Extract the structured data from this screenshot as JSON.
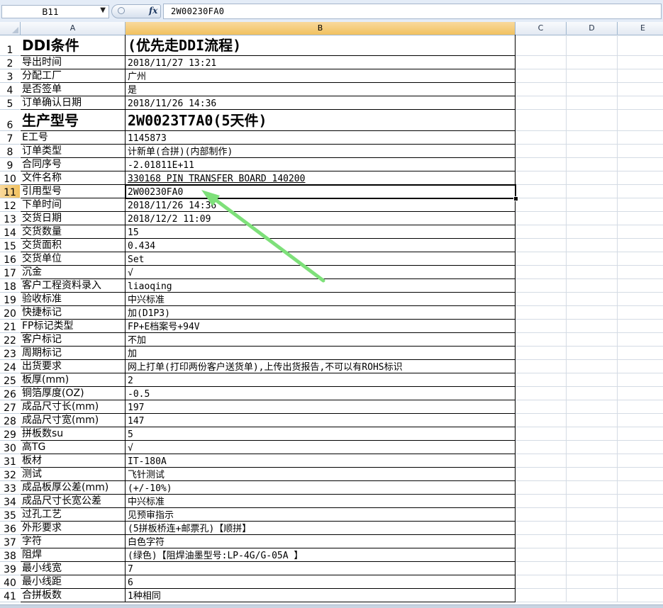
{
  "formula_bar": {
    "cell_ref": "B11",
    "dropdown_glyph": "▼",
    "fx_label": "fx",
    "value": "2W00230FA0"
  },
  "columns": [
    "A",
    "B",
    "C",
    "D",
    "E"
  ],
  "selected": {
    "column": "B",
    "row": "11"
  },
  "rows": [
    {
      "n": "1",
      "a": "DDI条件",
      "b": "(优先走DDI流程)",
      "style": "big"
    },
    {
      "n": "2",
      "a": "导出时间",
      "b": "2018/11/27 13:21"
    },
    {
      "n": "3",
      "a": "分配工厂",
      "b": "广州"
    },
    {
      "n": "4",
      "a": "是否签单",
      "b": "是"
    },
    {
      "n": "5",
      "a": "订单确认日期",
      "b": "2018/11/26 14:36"
    },
    {
      "n": "6",
      "a": "生产型号",
      "b": "2W0023T7A0(5天件)",
      "style": "big"
    },
    {
      "n": "7",
      "a": "E工号",
      "b": "1145873"
    },
    {
      "n": "8",
      "a": "订单类型",
      "b": "计新单(合拼)(内部制作)"
    },
    {
      "n": "9",
      "a": "合同序号",
      "b": "-2.01811E+11"
    },
    {
      "n": "10",
      "a": "文件名称",
      "b": "330168 PIN TRANSFER BOARD 140200",
      "underline": true
    },
    {
      "n": "11",
      "a": "引用型号",
      "b": "2W00230FA0"
    },
    {
      "n": "12",
      "a": "下单时间",
      "b": "2018/11/26 14:36"
    },
    {
      "n": "13",
      "a": "交货日期",
      "b": "2018/12/2 11:09"
    },
    {
      "n": "14",
      "a": "交货数量",
      "b": "15"
    },
    {
      "n": "15",
      "a": "交货面积",
      "b": "0.434"
    },
    {
      "n": "16",
      "a": "交货单位",
      "b": "Set"
    },
    {
      "n": "17",
      "a": "沉金",
      "b": "√"
    },
    {
      "n": "18",
      "a": "客户工程资料录入",
      "b": "liaoqing"
    },
    {
      "n": "19",
      "a": "验收标准",
      "b": "中兴标准"
    },
    {
      "n": "20",
      "a": "快捷标记",
      "b": "加(D1P3)"
    },
    {
      "n": "21",
      "a": "FP标记类型",
      "b": "FP+E档案号+94V"
    },
    {
      "n": "22",
      "a": "客户标记",
      "b": "不加"
    },
    {
      "n": "23",
      "a": "周期标记",
      "b": "加"
    },
    {
      "n": "24",
      "a": "出货要求",
      "b": "网上打单(打印两份客户送货单),上传出货报告,不可以有ROHS标识"
    },
    {
      "n": "25",
      "a": "板厚(mm)",
      "b": "2"
    },
    {
      "n": "26",
      "a": "铜箔厚度(OZ)",
      "b": "-0.5"
    },
    {
      "n": "27",
      "a": "成品尺寸长(mm)",
      "b": "197"
    },
    {
      "n": "28",
      "a": "成品尺寸宽(mm)",
      "b": "147"
    },
    {
      "n": "29",
      "a": "拼板数su",
      "b": "5"
    },
    {
      "n": "30",
      "a": "高TG",
      "b": "√"
    },
    {
      "n": "31",
      "a": "板材",
      "b": "IT-180A"
    },
    {
      "n": "32",
      "a": "测试",
      "b": "飞针测试"
    },
    {
      "n": "33",
      "a": "成品板厚公差(mm)",
      "b": "(+/-10%)"
    },
    {
      "n": "34",
      "a": "成品尺寸长宽公差",
      "b": "中兴标准"
    },
    {
      "n": "35",
      "a": "过孔工艺",
      "b": "见预审指示"
    },
    {
      "n": "36",
      "a": "外形要求",
      "b": "(5拼板桥连+邮票孔)【顺拼】"
    },
    {
      "n": "37",
      "a": "字符",
      "b": "白色字符"
    },
    {
      "n": "38",
      "a": "阻焊",
      "b": "(绿色)【阻焊油墨型号:LP-4G/G-05A 】"
    },
    {
      "n": "39",
      "a": "最小线宽",
      "b": "7"
    },
    {
      "n": "40",
      "a": "最小线距",
      "b": "6"
    },
    {
      "n": "41",
      "a": "合拼板数",
      "b": "1种相同"
    }
  ],
  "annotation_arrow": {
    "color": "#7ee07a"
  }
}
